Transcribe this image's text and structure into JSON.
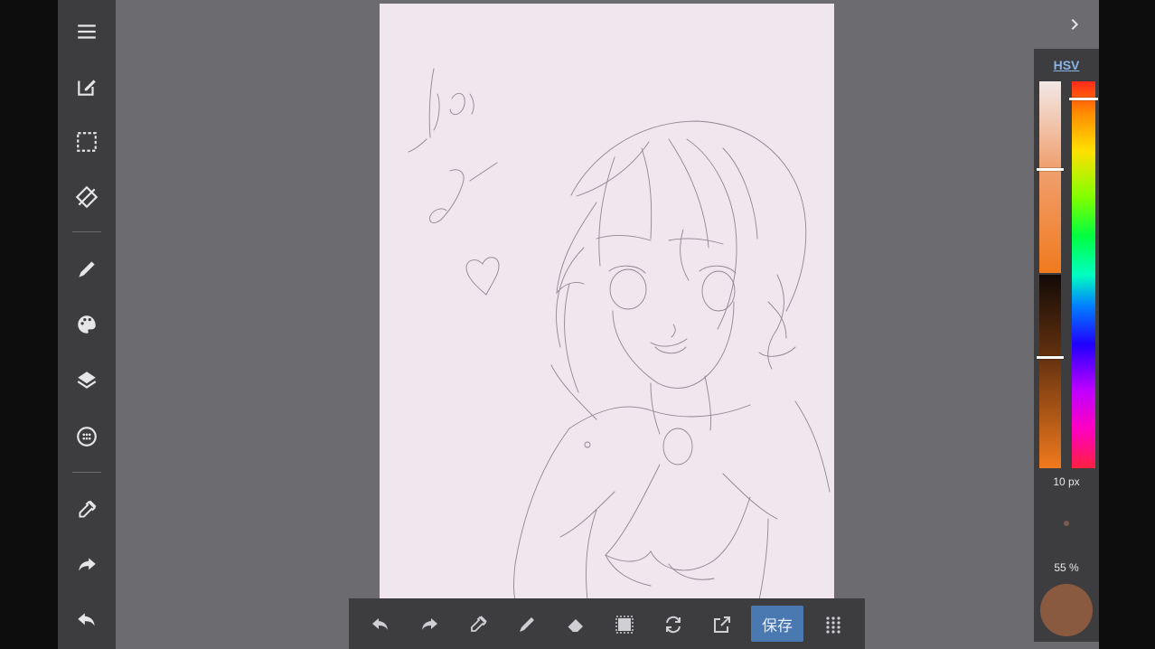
{
  "left_toolbar": {
    "items": [
      {
        "name": "menu",
        "icon": "menu-icon"
      },
      {
        "name": "new-edit",
        "icon": "edit-icon"
      },
      {
        "name": "select",
        "icon": "selection-icon"
      },
      {
        "name": "rotate",
        "icon": "rotate-icon"
      },
      {
        "name": "brush",
        "icon": "brush-icon"
      },
      {
        "name": "palette",
        "icon": "palette-icon"
      },
      {
        "name": "layers",
        "icon": "layers-icon"
      },
      {
        "name": "materials",
        "icon": "material-icon"
      },
      {
        "name": "eyedropper",
        "icon": "eyedropper-icon"
      },
      {
        "name": "redo",
        "icon": "redo-icon"
      },
      {
        "name": "undo",
        "icon": "undo-icon"
      }
    ]
  },
  "bottom_bar": {
    "buttons": [
      "undo-icon",
      "redo-icon",
      "eyedropper-icon",
      "pen-icon",
      "eraser-icon",
      "select-all-icon",
      "transform-icon",
      "export-icon"
    ],
    "save_label": "保存",
    "grid_icon": "apps-grid-icon"
  },
  "color_panel": {
    "mode_label": "HSV",
    "brush_size": "10 px",
    "opacity": "55 %",
    "current_color": "#8a5a40",
    "hue_gradient": "red-orange-yellow-green-cyan-blue-magenta",
    "selected_hue_color": "#ff7a1a"
  },
  "colors": {
    "toolbar_bg": "#3d3d40",
    "workspace_bg": "#6c6b70",
    "canvas_bg": "#efe6ee",
    "accent": "#4a78b0",
    "hsv_link": "#8ab4e8"
  }
}
